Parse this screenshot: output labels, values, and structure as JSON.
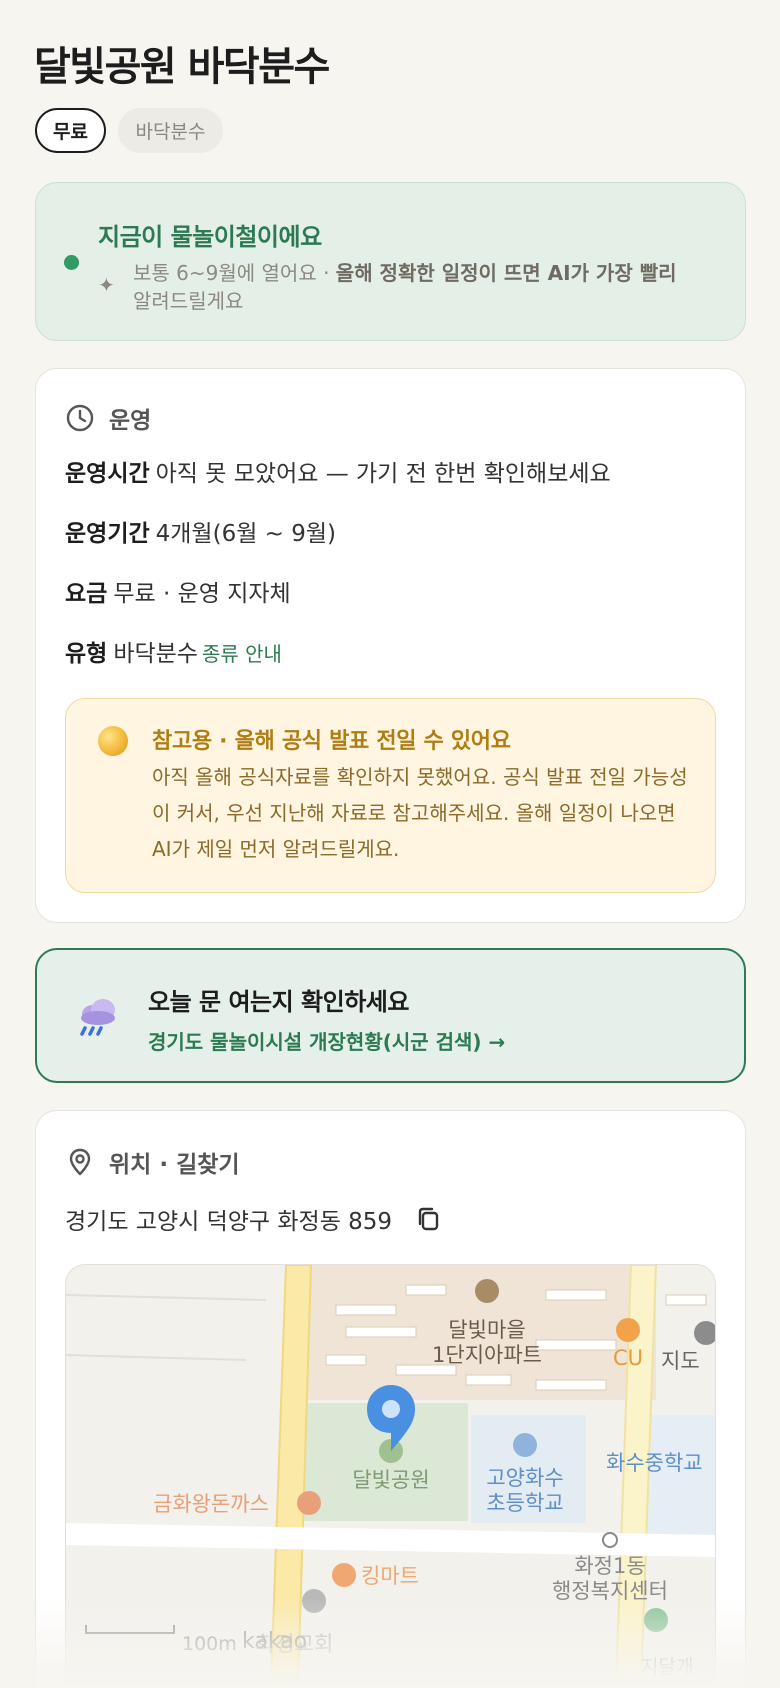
{
  "header": {
    "title": "달빛공원 바닥분수",
    "chips": [
      "무료",
      "바닥분수"
    ]
  },
  "season": {
    "title": "지금이 물놀이철이에요",
    "text_prefix": "보통 6~9월에 열어요 · ",
    "text_bold": "올해 정확한 일정이 뜨면 AI가 가장 빨리",
    "text_suffix": "알려드릴게요"
  },
  "operation": {
    "heading": "운영",
    "rows": [
      {
        "key": "운영시간",
        "value": "아직 못 모았어요 — 가기 전 한번 확인해보세요"
      },
      {
        "key": "운영기간",
        "value": "4개월(6월 ~ 9월)"
      },
      {
        "key": "요금",
        "value": "무료 · 운영 지자체"
      },
      {
        "key": "유형",
        "value": "바닥분수",
        "link": "종류 안내"
      }
    ],
    "notice": {
      "title": "참고용 · 올해 공식 발표 전일 수 있어요",
      "text": "아직 올해 공식자료를 확인하지 못했어요. 공식 발표 전일 가능성이 커서, 우선 지난해 자료로 참고해주세요. 올해 일정이 나오면 AI가 제일 먼저 알려드릴게요."
    }
  },
  "today_check": {
    "title": "오늘 문 여는지 확인하세요",
    "link": "경기도 물놀이시설 개장현황(시군 검색) →"
  },
  "location": {
    "heading": "위치 · 길찾기",
    "address": "경기도 고양시 덕양구 화정동 859",
    "map": {
      "labels": {
        "apt": [
          "달빛마을",
          "1단지아파트"
        ],
        "cu": "CU",
        "jido": "지도",
        "park": "달빛공원",
        "school": [
          "고양화수",
          "초등학교"
        ],
        "middle_school": "화수중학교",
        "restaurant": "금화왕돈까스",
        "mart": "킹마트",
        "center": [
          "화정1동",
          "행정복지센터"
        ],
        "church": "화정교회",
        "scale": "100m",
        "brand": "kakao",
        "bottom_right": "지달개"
      }
    }
  },
  "colors": {
    "accent_green": "#2b7a52",
    "notice_gold": "#b07d14",
    "background": "#f7f5f0"
  }
}
